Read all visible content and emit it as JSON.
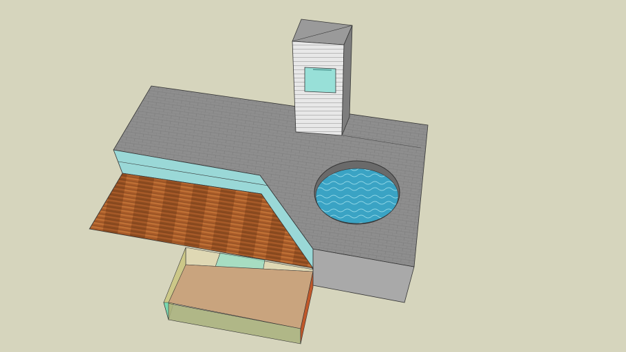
{
  "scene": {
    "colors": {
      "background": "#d6d5bd",
      "slab_top": "#8c8c8c",
      "slab_side": "#a9a9a9",
      "glass": "#8fd8dc",
      "wood": "#a65a28",
      "water": "#3aa3c4",
      "box": "#c9a47e",
      "tower": "#e6e6e6",
      "window": "#98e0d8"
    }
  }
}
